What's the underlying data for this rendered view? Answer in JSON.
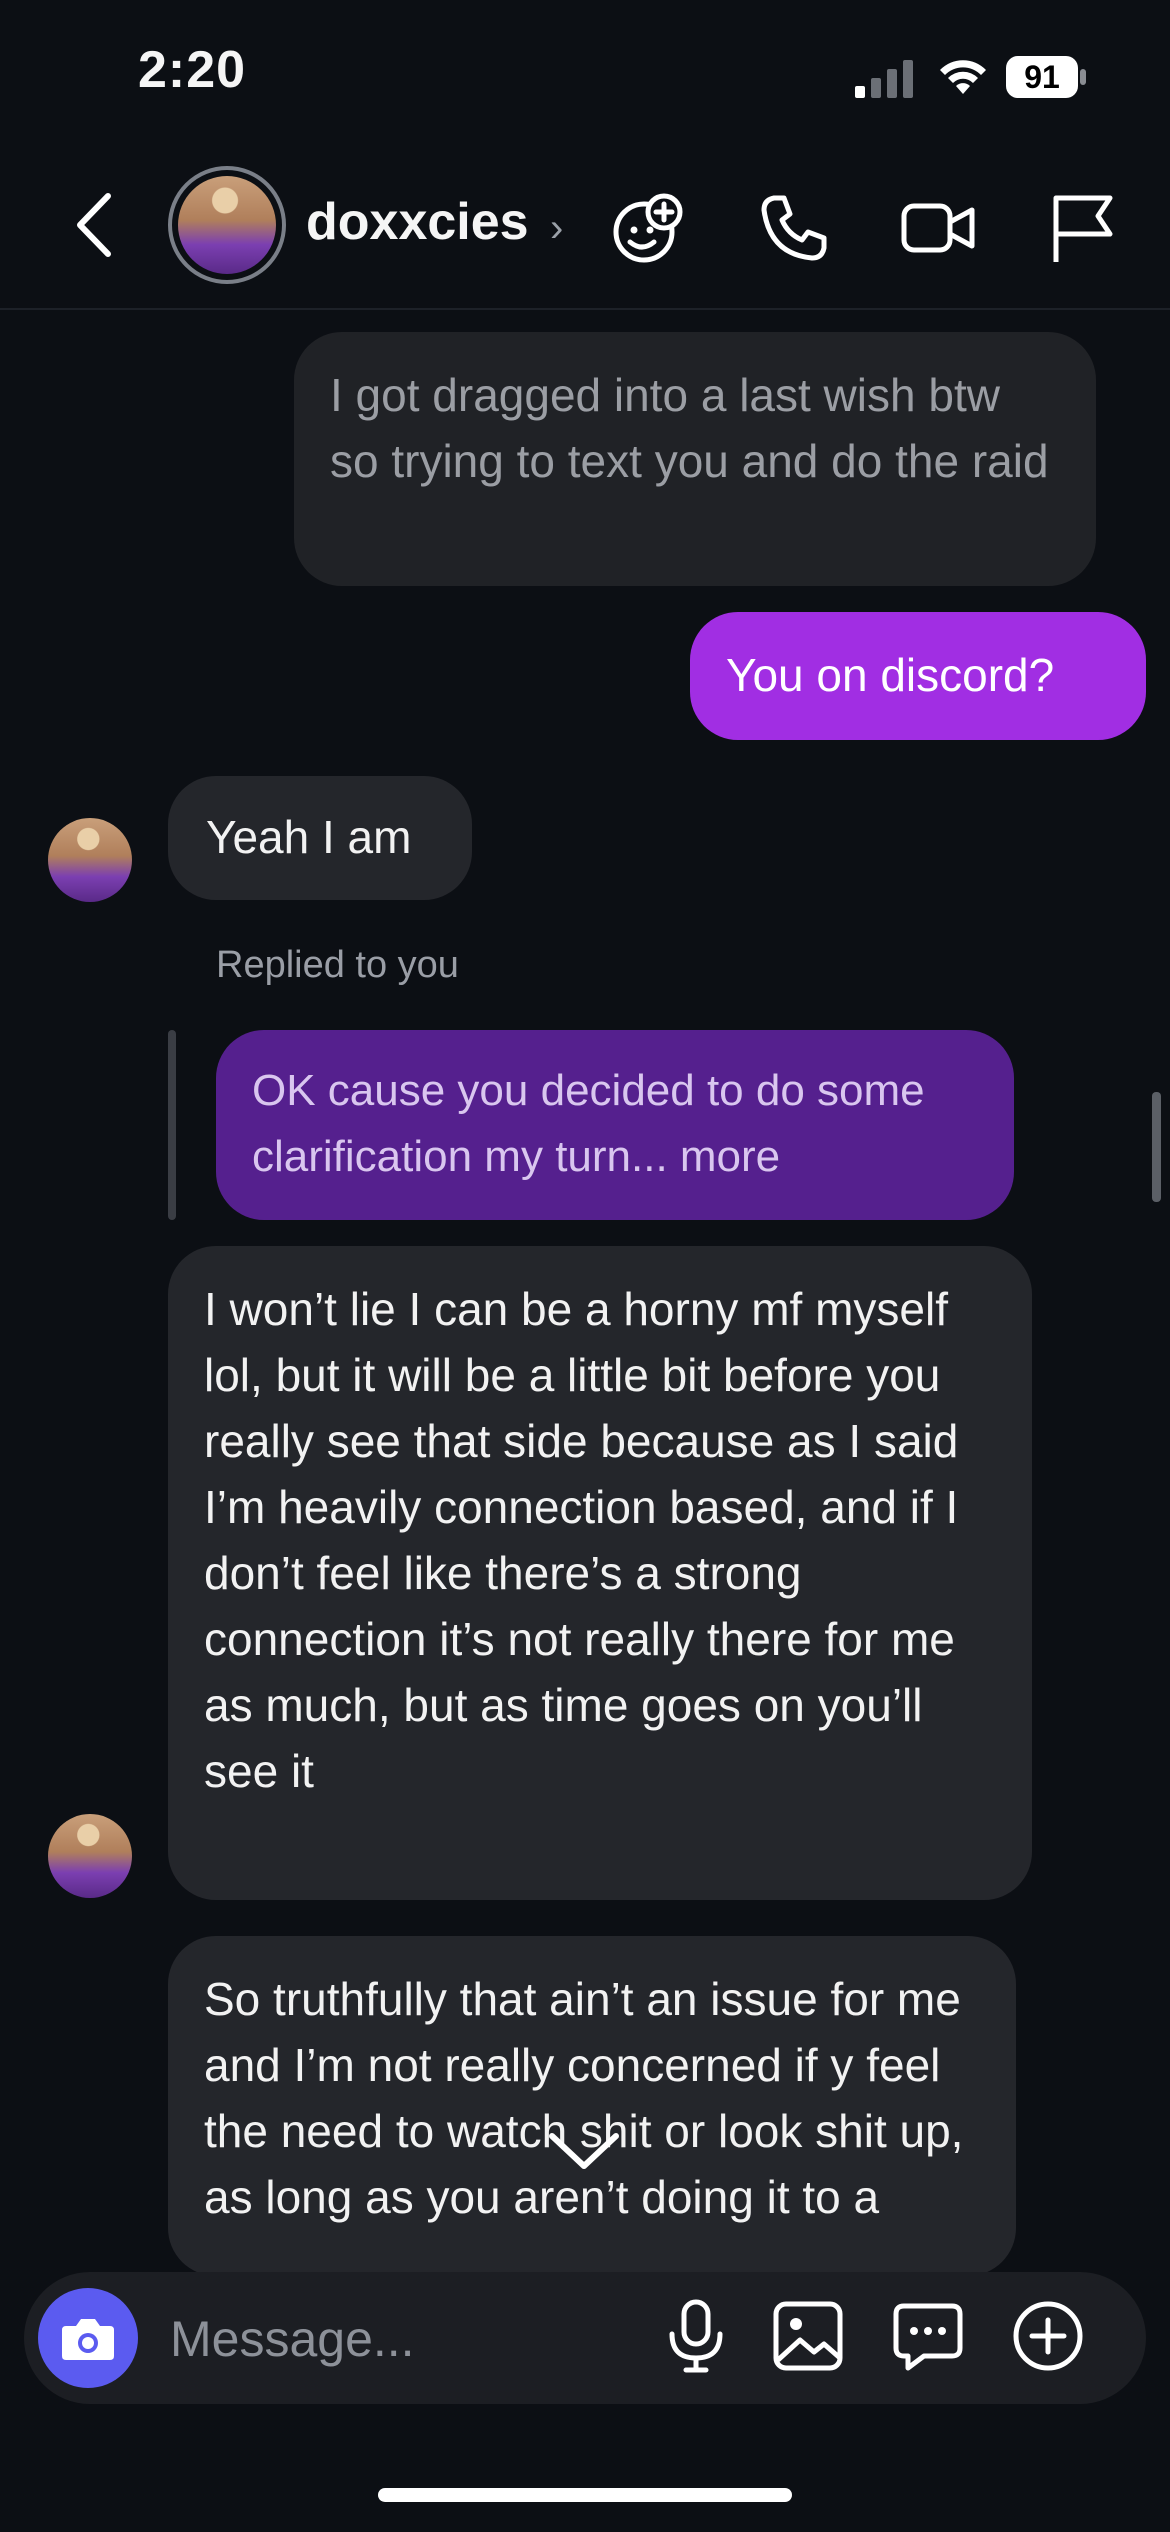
{
  "status_bar": {
    "time": "2:20",
    "battery": "91"
  },
  "header": {
    "username": "doxxcies",
    "chevron": "›"
  },
  "messages": [
    {
      "sender": "them",
      "text": "I got dragged into a last wish btw so trying to text you and do the raid"
    },
    {
      "sender": "me",
      "text": "You on discord?"
    },
    {
      "sender": "them",
      "text": "Yeah I am"
    },
    {
      "sender": "them",
      "reply_label": "Replied to you",
      "quoted": "OK cause you decided to do some clarification my turn... more"
    },
    {
      "sender": "them",
      "text": "I won’t lie I can be a horny mf myself lol, but it will be a little bit before you really see that side because as I said I’m heavily connection based, and if I don’t feel like there’s a strong connection it’s not really there for me as much, but as time goes on you’ll see it"
    },
    {
      "sender": "them",
      "text": "So truthfully that ain’t an issue for me and I’m not really concerned if y feel the need to watch shit or look shit up, as long as you aren’t doing it to a"
    }
  ],
  "composer": {
    "placeholder": "Message..."
  },
  "colors": {
    "accent": "#a12ee3",
    "reply_bubble": "#55208e",
    "background": "#0c0f14",
    "camera_button": "#5b5bf0"
  },
  "icons": [
    "back-icon",
    "effects-icon",
    "phone-icon",
    "video-icon",
    "flag-icon",
    "camera-icon",
    "microphone-icon",
    "gallery-icon",
    "sticker-icon",
    "plus-icon",
    "chevron-down-icon"
  ]
}
